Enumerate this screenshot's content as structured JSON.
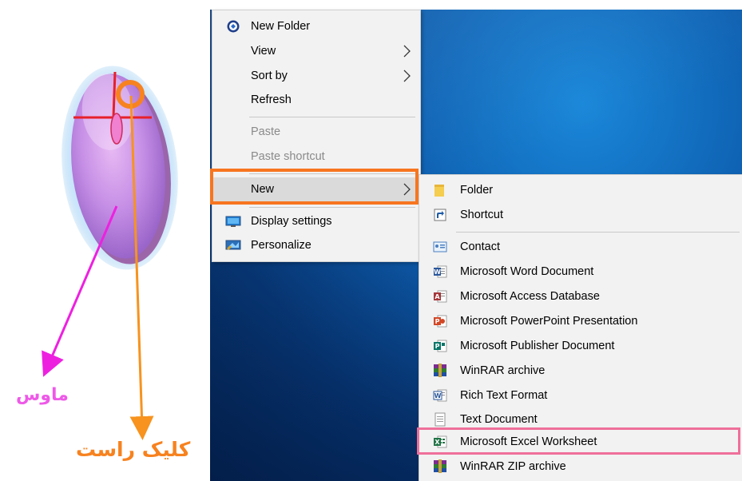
{
  "context_menu": {
    "items": [
      {
        "label": "New Folder",
        "icon": "new-folder-icon",
        "enabled": true
      },
      {
        "label": "View",
        "submenu": true,
        "enabled": true
      },
      {
        "label": "Sort by",
        "submenu": true,
        "enabled": true
      },
      {
        "label": "Refresh",
        "enabled": true
      },
      {
        "label": "Paste",
        "enabled": false
      },
      {
        "label": "Paste shortcut",
        "enabled": false
      },
      {
        "label": "New",
        "submenu": true,
        "enabled": true,
        "highlighted": true
      },
      {
        "label": "Display settings",
        "icon": "display-settings-icon",
        "enabled": true
      },
      {
        "label": "Personalize",
        "icon": "personalize-icon",
        "enabled": true
      }
    ]
  },
  "new_submenu": {
    "items": [
      {
        "label": "Folder",
        "icon": "folder-icon"
      },
      {
        "label": "Shortcut",
        "icon": "shortcut-icon"
      },
      {
        "label": "Contact",
        "icon": "contact-icon"
      },
      {
        "label": "Microsoft Word Document",
        "icon": "word-icon"
      },
      {
        "label": "Microsoft Access Database",
        "icon": "access-icon"
      },
      {
        "label": "Microsoft PowerPoint Presentation",
        "icon": "powerpoint-icon"
      },
      {
        "label": "Microsoft Publisher Document",
        "icon": "publisher-icon"
      },
      {
        "label": "WinRAR archive",
        "icon": "winrar-icon"
      },
      {
        "label": "Rich Text Format",
        "icon": "rtf-icon"
      },
      {
        "label": "Text Document",
        "icon": "text-document-icon"
      },
      {
        "label": "Microsoft Excel Worksheet",
        "icon": "excel-icon",
        "highlighted": true
      },
      {
        "label": "WinRAR ZIP archive",
        "icon": "winrar-zip-icon"
      }
    ]
  },
  "annotations": {
    "mouse_label": "ماوس",
    "right_click_label": "کلیک راست"
  },
  "colors": {
    "highlight_new": "#f7751f",
    "highlight_excel": "#ef6f9a",
    "mouse_arrow": "#ee20e0",
    "click_arrow": "#f7931e",
    "menu_bg": "#f2f2f2",
    "desktop_blue": "#0e5fb0"
  }
}
